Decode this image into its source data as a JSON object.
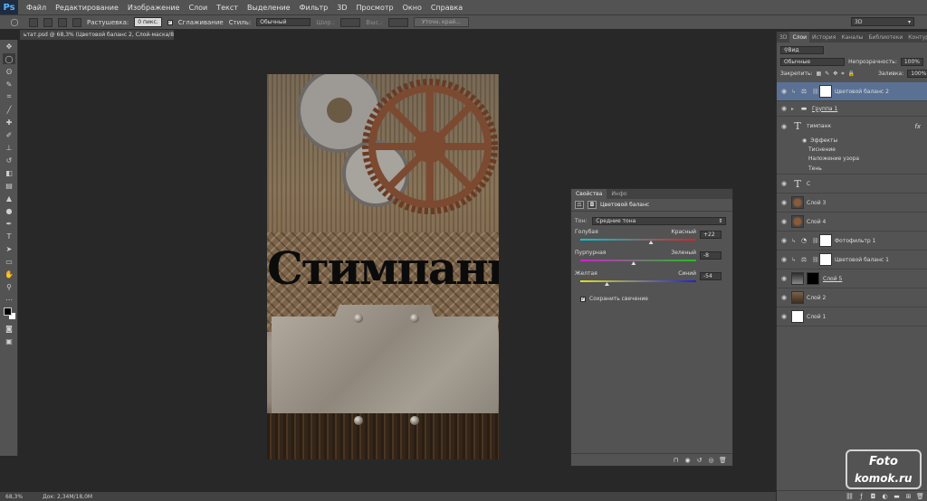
{
  "app": {
    "logo": "Ps"
  },
  "menu": [
    "Файл",
    "Редактирование",
    "Изображение",
    "Слои",
    "Текст",
    "Выделение",
    "Фильтр",
    "3D",
    "Просмотр",
    "Окно",
    "Справка"
  ],
  "options": {
    "feather_label": "Растушевка:",
    "feather_value": "0 пикс.",
    "antialias_label": "Сглаживание",
    "style_label": "Стиль:",
    "style_value": "Обычный",
    "width_label": "Шир.:",
    "height_label": "Выс.:",
    "refine_button": "Уточн. край...",
    "workspace": "3D"
  },
  "document": {
    "tab_title": "ьтат.psd @ 68,3% (Цветовой баланс 2, Слой-маска/8) *",
    "canvas_text": "Стимпанк"
  },
  "status": {
    "zoom": "68,3%",
    "doc_size": "Док: 2,34M/18,0M"
  },
  "properties": {
    "tabs": [
      "Свойства",
      "Инфо"
    ],
    "title": "Цветовой баланс",
    "tone_label": "Тон:",
    "tone_value": "Средние тона",
    "sliders": [
      {
        "left": "Голубая",
        "right": "Красный",
        "value": "+22",
        "fraction": 0.61,
        "gradient": "linear-gradient(90deg,#00c8d8,#e02020)"
      },
      {
        "left": "Пурпурная",
        "right": "Зеленый",
        "value": "-8",
        "fraction": 0.46,
        "gradient": "linear-gradient(90deg,#d020d0,#20c020)"
      },
      {
        "left": "Желтая",
        "right": "Синий",
        "value": "-54",
        "fraction": 0.23,
        "gradient": "linear-gradient(90deg,#e0e020,#2020e0)"
      }
    ],
    "preserve_label": "Сохранить свечение"
  },
  "right_tabs": [
    "3D",
    "Слои",
    "История",
    "Каналы",
    "Библиотеки",
    "Контуры"
  ],
  "layers_panel": {
    "kind_label": "Вид",
    "blend_mode": "Обычные",
    "opacity_label": "Непрозрачность:",
    "opacity_value": "100%",
    "lock_label": "Закрепить:",
    "fill_label": "Заливка:",
    "fill_value": "100%"
  },
  "layers": {
    "l0": "Цветовой баланс 2",
    "l1": "Группа 1",
    "l2": "тимпанк",
    "l2_effects": "Эффекты",
    "l2_e1": "Тиснение",
    "l2_e2": "Наложение узора",
    "l2_e3": "Тень",
    "l3": "С",
    "l4": "Слой 3",
    "l5": "Слой 4",
    "l6": "Фотофильтр 1",
    "l7": "Цветовой баланс 1",
    "l8": "Слой 5",
    "l9": "Слой 2",
    "l10": "Слой 1",
    "fx": "fx"
  },
  "watermark": {
    "line1": "Foto",
    "line2": "komok.ru"
  }
}
